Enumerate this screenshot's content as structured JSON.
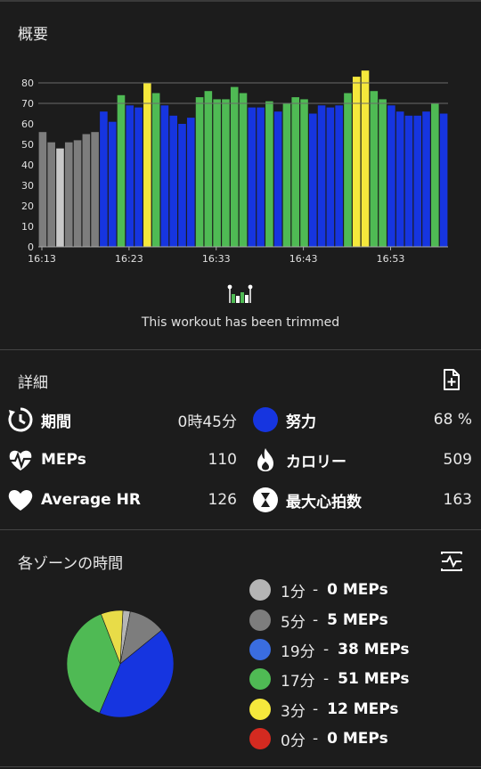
{
  "overview": {
    "title": "概要"
  },
  "trim": {
    "message": "This workout has been trimmed",
    "icon": "trim-chart-icon"
  },
  "chart_data": {
    "type": "bar",
    "y_ticks": [
      "0",
      "10",
      "20",
      "30",
      "40",
      "50",
      "60",
      "70",
      "80"
    ],
    "ylim": [
      0,
      90
    ],
    "x_tick_labels": [
      "16:13",
      "16:23",
      "16:33",
      "16:43",
      "16:53"
    ],
    "x_tick_minutes": [
      0,
      10,
      20,
      30,
      40
    ],
    "gridlines": [
      70,
      80
    ],
    "values": [
      56,
      51,
      48,
      51,
      52,
      55,
      56,
      66,
      61,
      74,
      69,
      68,
      80,
      75,
      69,
      64,
      60,
      63,
      73,
      76,
      72,
      72,
      78,
      75,
      68,
      68,
      71,
      66,
      70,
      73,
      72,
      65,
      69,
      68,
      69,
      75,
      83,
      86,
      76,
      72,
      69,
      66,
      64,
      64,
      66,
      70,
      65
    ],
    "zones": [
      1,
      1,
      0,
      1,
      1,
      1,
      1,
      2,
      2,
      3,
      2,
      2,
      4,
      3,
      2,
      2,
      2,
      2,
      3,
      3,
      3,
      3,
      3,
      3,
      2,
      2,
      3,
      2,
      3,
      3,
      3,
      2,
      2,
      2,
      2,
      3,
      4,
      4,
      3,
      3,
      2,
      2,
      2,
      2,
      2,
      3,
      2
    ],
    "zone_colors": [
      "#c8c8c8",
      "#7d7d7d",
      "#1635e0",
      "#4fba54",
      "#f5e83c"
    ]
  },
  "details": {
    "title": "詳細",
    "export_icon": "file-add-icon",
    "stats": [
      {
        "label": "期間",
        "value": "0時45分",
        "icon": "duration-icon"
      },
      {
        "label": "努力",
        "value": "68 %",
        "icon": "effort-dot-icon"
      },
      {
        "label": "MEPs",
        "value": "110",
        "icon": "heart-pulse-icon"
      },
      {
        "label": "カロリー",
        "value": "509",
        "icon": "flame-icon"
      },
      {
        "label": "Average HR",
        "value": "126",
        "icon": "heart-icon"
      },
      {
        "label": "最大心拍数",
        "value": "163",
        "icon": "hourglass-icon"
      }
    ]
  },
  "zones": {
    "title": "各ゾーンの時間",
    "toggle_icon": "zone-chart-toggle-icon",
    "items": [
      {
        "minutes": "1分",
        "dash": "-",
        "meps": "0 MEPs",
        "color": "#b5b5b5"
      },
      {
        "minutes": "5分",
        "dash": "-",
        "meps": "5 MEPs",
        "color": "#7d7d7d"
      },
      {
        "minutes": "19分",
        "dash": "-",
        "meps": "38 MEPs",
        "color": "#3a6de0"
      },
      {
        "minutes": "17分",
        "dash": "-",
        "meps": "51 MEPs",
        "color": "#4fba54"
      },
      {
        "minutes": "3分",
        "dash": "-",
        "meps": "12 MEPs",
        "color": "#f5e83c"
      },
      {
        "minutes": "0分",
        "dash": "-",
        "meps": "0 MEPs",
        "color": "#d42a20"
      }
    ],
    "pie_colors": [
      "#b5b5b5",
      "#7d7d7d",
      "#1635e0",
      "#4fba54",
      "#e8dc48",
      "#d42a20"
    ],
    "pie_minutes": [
      1,
      5,
      19,
      17,
      3,
      0
    ]
  }
}
